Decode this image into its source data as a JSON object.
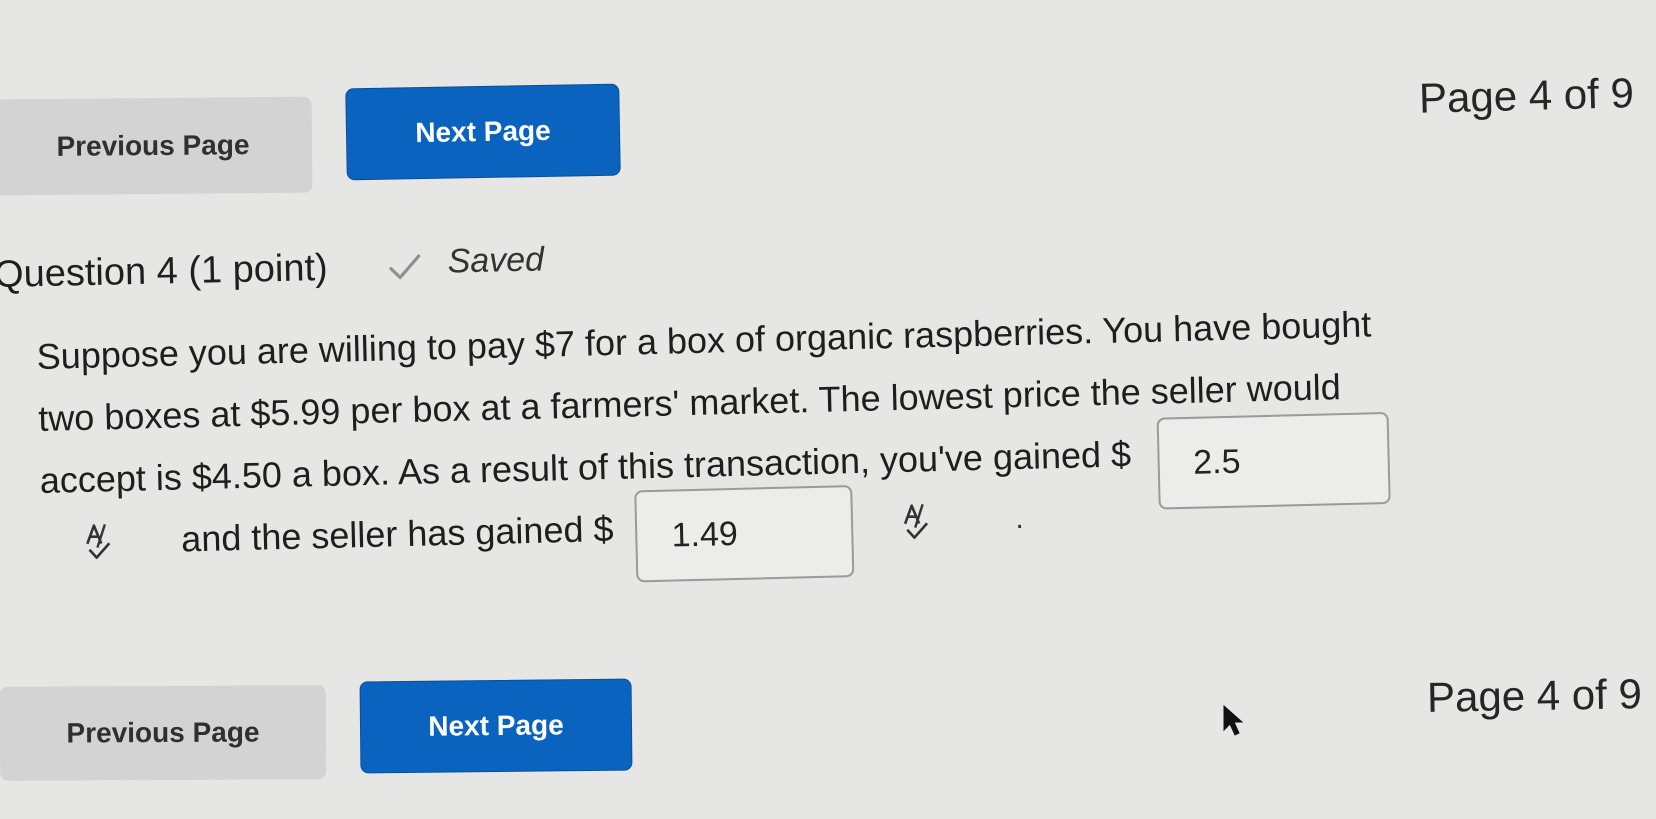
{
  "navigation": {
    "previous_label": "Previous Page",
    "next_label": "Next Page",
    "page_indicator": "Page 4 of 9",
    "current_page": 4,
    "total_pages": 9
  },
  "question": {
    "title": "Question 4 (1 point)",
    "status": "Saved",
    "status_icon": "check-icon",
    "text": {
      "line1": "Suppose you are willing to pay $7 for a box of organic raspberries. You have bought",
      "line2": "two boxes at $5.99 per box at a farmers' market. The lowest price the seller would",
      "line3_prefix": "accept is $4.50 a box. As a result of this transaction, you've gained $",
      "line4_prefix": "and the seller has gained $",
      "line4_suffix": "."
    },
    "answers": [
      {
        "label": "you've gained",
        "value": "2.5"
      },
      {
        "label": "seller has gained",
        "value": "1.49"
      }
    ],
    "spellcheck_icon": "spell-check-icon"
  },
  "colors": {
    "background": "#e6e6e4",
    "next_button": "#0a63bf",
    "previous_button": "#d3d3d3"
  }
}
